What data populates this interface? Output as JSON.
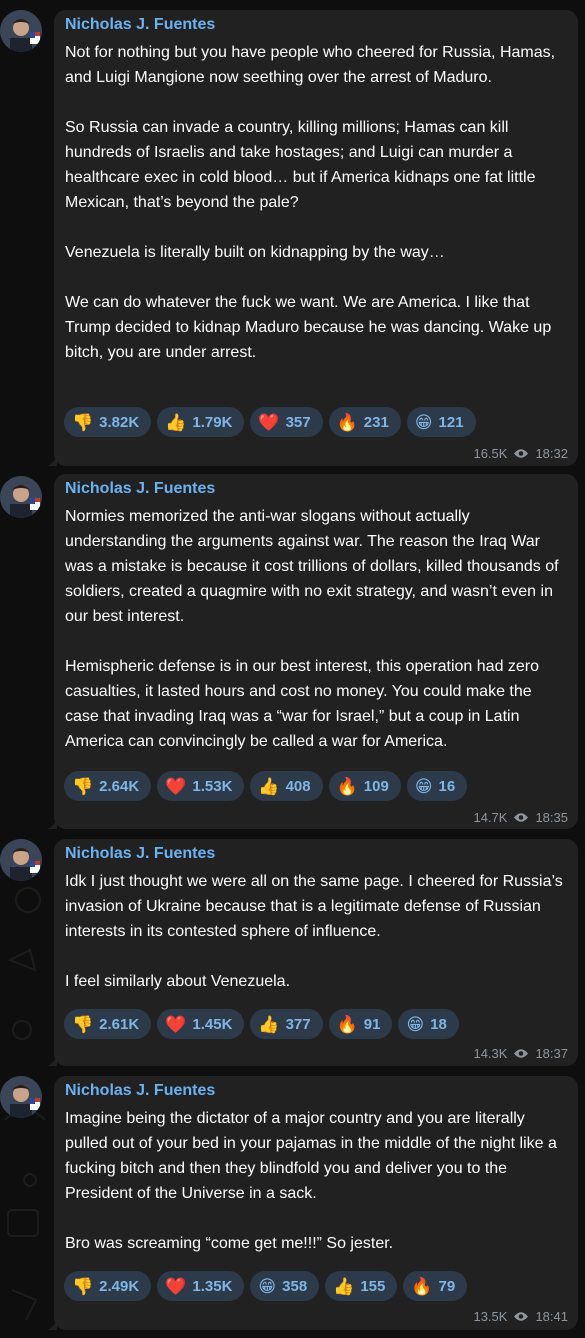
{
  "messages": [
    {
      "author": "Nicholas J. Fuentes",
      "paragraphs": [
        "Not for nothing but you have people who cheered for Russia, Hamas, and Luigi Mangione now seething over the arrest of Maduro.",
        "So Russia can invade a country, killing millions; Hamas can kill hundreds of Israelis and take hostages; and Luigi can murder a healthcare exec in cold blood… but if America kidnaps one fat little Mexican, that’s beyond the pale?",
        "Venezuela is literally built on kidnapping by the way…",
        "We can do whatever the fuck we want. We are America. I like that Trump decided to kidnap Maduro because he was dancing. Wake up bitch, you are under arrest."
      ],
      "reactions": [
        {
          "emoji": "👎",
          "count": "3.82K"
        },
        {
          "emoji": "👍",
          "count": "1.79K"
        },
        {
          "emoji": "❤️",
          "count": "357"
        },
        {
          "emoji": "🔥",
          "count": "231"
        },
        {
          "emoji": "😁",
          "count": "121"
        }
      ],
      "views": "16.5K",
      "time": "18:32"
    },
    {
      "author": "Nicholas J. Fuentes",
      "paragraphs": [
        "Normies memorized the anti-war slogans without actually understanding the arguments against war. The reason the Iraq War was a mistake is because it cost trillions of dollars, killed thousands of soldiers, created a quagmire with no exit strategy, and wasn’t even in our best interest.",
        "Hemispheric defense is in our best interest, this operation had zero casualties, it lasted hours and cost no money. You could make the case that invading Iraq was a “war for Israel,” but a coup in Latin America can convincingly be called a war for America."
      ],
      "reactions": [
        {
          "emoji": "👎",
          "count": "2.64K"
        },
        {
          "emoji": "❤️",
          "count": "1.53K"
        },
        {
          "emoji": "👍",
          "count": "408"
        },
        {
          "emoji": "🔥",
          "count": "109"
        },
        {
          "emoji": "😁",
          "count": "16"
        }
      ],
      "views": "14.7K",
      "time": "18:35"
    },
    {
      "author": "Nicholas J. Fuentes",
      "paragraphs": [
        "Idk I just thought we were all on the same page. I cheered for Russia’s invasion of Ukraine because that is a legitimate defense of Russian interests in its contested sphere of influence.",
        "I feel similarly about Venezuela."
      ],
      "reactions": [
        {
          "emoji": "👎",
          "count": "2.61K"
        },
        {
          "emoji": "❤️",
          "count": "1.45K"
        },
        {
          "emoji": "👍",
          "count": "377"
        },
        {
          "emoji": "🔥",
          "count": "91"
        },
        {
          "emoji": "😁",
          "count": "18"
        }
      ],
      "views": "14.3K",
      "time": "18:37"
    },
    {
      "author": "Nicholas J. Fuentes",
      "paragraphs": [
        "Imagine being the dictator of a major country and you are literally pulled out of your bed in your pajamas in the middle of the night like a fucking bitch and then they blindfold you and deliver you to the President of the Universe in a sack.",
        "Bro was screaming “come get me!!!” So jester."
      ],
      "reactions": [
        {
          "emoji": "👎",
          "count": "2.49K"
        },
        {
          "emoji": "❤️",
          "count": "1.35K"
        },
        {
          "emoji": "😁",
          "count": "358"
        },
        {
          "emoji": "👍",
          "count": "155"
        },
        {
          "emoji": "🔥",
          "count": "79"
        }
      ],
      "views": "13.5K",
      "time": "18:41"
    }
  ]
}
